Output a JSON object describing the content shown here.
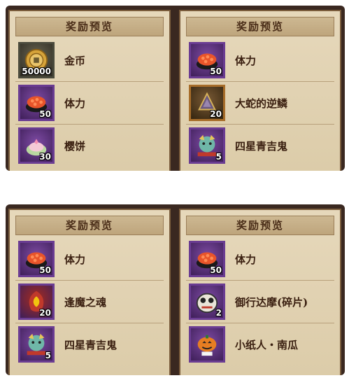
{
  "screenshots": [
    {
      "left": {
        "title": "奖励预览",
        "items": [
          {
            "name": "金币",
            "qty": "50000",
            "icon": "gold-coin-icon"
          },
          {
            "name": "体力",
            "qty": "50",
            "icon": "sushi-stamina-icon"
          },
          {
            "name": "樱饼",
            "qty": "30",
            "icon": "sakura-mochi-icon"
          }
        ]
      },
      "right": {
        "title": "奖励预览",
        "items": [
          {
            "name": "体力",
            "qty": "50",
            "icon": "sushi-stamina-icon"
          },
          {
            "name": "大蛇的逆鳞",
            "qty": "20",
            "icon": "orochi-scale-icon"
          },
          {
            "name": "四星青吉鬼",
            "qty": "5",
            "icon": "blue-goblin-icon"
          }
        ]
      }
    },
    {
      "left": {
        "title": "奖励预览",
        "items": [
          {
            "name": "体力",
            "qty": "50",
            "icon": "sushi-stamina-icon"
          },
          {
            "name": "逢魔之魂",
            "qty": "20",
            "icon": "demon-soul-icon"
          },
          {
            "name": "四星青吉鬼",
            "qty": "5",
            "icon": "blue-goblin-icon"
          }
        ]
      },
      "right": {
        "title": "奖励预览",
        "items": [
          {
            "name": "体力",
            "qty": "50",
            "icon": "sushi-stamina-icon"
          },
          {
            "name": "御行达摩(碎片)",
            "qty": "2",
            "icon": "daruma-shard-icon"
          },
          {
            "name": "小纸人・南瓜",
            "qty": "",
            "icon": "pumpkin-paper-doll-icon"
          }
        ]
      }
    }
  ]
}
